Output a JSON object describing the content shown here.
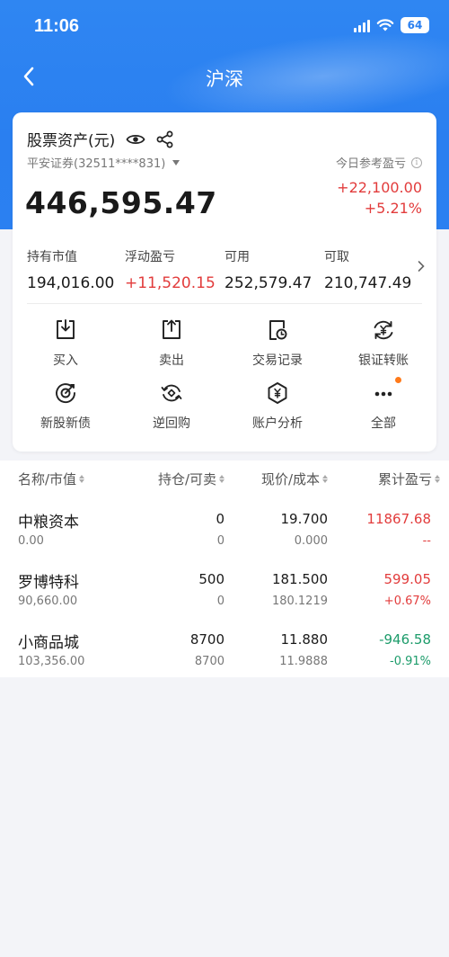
{
  "status_bar": {
    "time": "11:06",
    "battery": "64"
  },
  "nav": {
    "title": "沪深"
  },
  "asset": {
    "title": "股票资产(元)",
    "account": "平安证券(32511****831)",
    "ref_label": "今日参考盈亏",
    "total": "446,595.47",
    "pnl_amount": "+22,100.00",
    "pnl_percent": "+5.21%"
  },
  "stats": [
    {
      "label": "持有市值",
      "value": "194,016.00",
      "color": "#1a1a1a"
    },
    {
      "label": "浮动盈亏",
      "value": "+11,520.15",
      "color": "#e23c3c"
    },
    {
      "label": "可用",
      "value": "252,579.47",
      "color": "#1a1a1a"
    },
    {
      "label": "可取",
      "value": "210,747.49",
      "color": "#1a1a1a"
    }
  ],
  "actions": [
    {
      "label": "买入",
      "icon": "buy-icon"
    },
    {
      "label": "卖出",
      "icon": "sell-icon"
    },
    {
      "label": "交易记录",
      "icon": "trade-record-icon"
    },
    {
      "label": "银证转账",
      "icon": "bank-transfer-icon"
    },
    {
      "label": "新股新债",
      "icon": "ipo-icon"
    },
    {
      "label": "逆回购",
      "icon": "reverse-repo-icon"
    },
    {
      "label": "账户分析",
      "icon": "account-analysis-icon"
    },
    {
      "label": "全部",
      "icon": "more-icon"
    }
  ],
  "table": {
    "headers": [
      "名称/市值",
      "持仓/可卖",
      "现价/成本",
      "累计盈亏"
    ],
    "rows": [
      {
        "name": "中粮资本",
        "market_value": "0.00",
        "holding": "0",
        "available": "0",
        "price": "19.700",
        "cost": "0.000",
        "pnl": "11867.68",
        "pnl_pct": "--",
        "tone": "up"
      },
      {
        "name": "罗博特科",
        "market_value": "90,660.00",
        "holding": "500",
        "available": "0",
        "price": "181.500",
        "cost": "180.1219",
        "pnl": "599.05",
        "pnl_pct": "+0.67%",
        "tone": "up"
      },
      {
        "name": "小商品城",
        "market_value": "103,356.00",
        "holding": "8700",
        "available": "8700",
        "price": "11.880",
        "cost": "11.9888",
        "pnl": "-946.58",
        "pnl_pct": "-0.91%",
        "tone": "down"
      }
    ]
  },
  "colors": {
    "accent": "#2a7ff0",
    "up": "#e23c3c",
    "down": "#1d9c6b",
    "badge": "#ff7a1a"
  }
}
